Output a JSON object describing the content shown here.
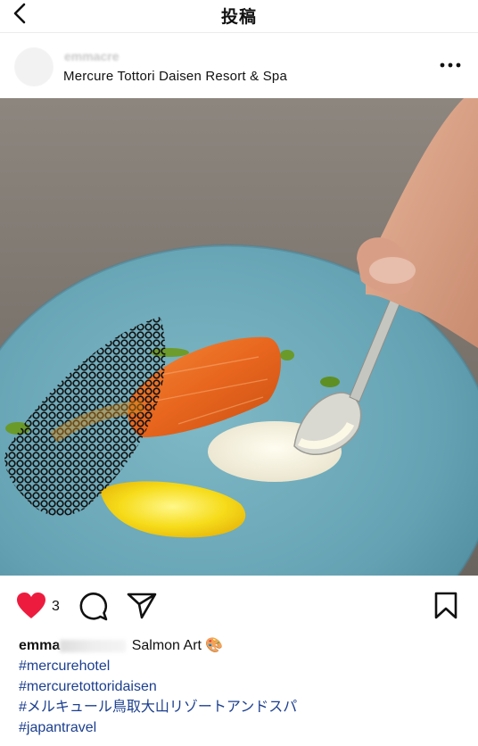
{
  "nav": {
    "title": "投稿"
  },
  "post": {
    "username_hidden": "emmacre",
    "location": "Mercure Tottori Daisen Resort & Spa"
  },
  "actions": {
    "like_count": "3"
  },
  "caption": {
    "username": "emma",
    "text": "Salmon Art 🎨",
    "hashtags": [
      "#mercurehotel",
      "#mercuretottoridaisen",
      "#メルキュール鳥取大山リゾートアンドスパ",
      "#japantravel"
    ]
  },
  "colors": {
    "like": "#ed1c3f",
    "hashtag": "#1c3f8f",
    "plate": "#6aa6b6"
  },
  "icons": [
    "back-chevron-icon",
    "more-dots-icon",
    "heart-icon",
    "comment-icon",
    "share-icon",
    "bookmark-icon"
  ]
}
